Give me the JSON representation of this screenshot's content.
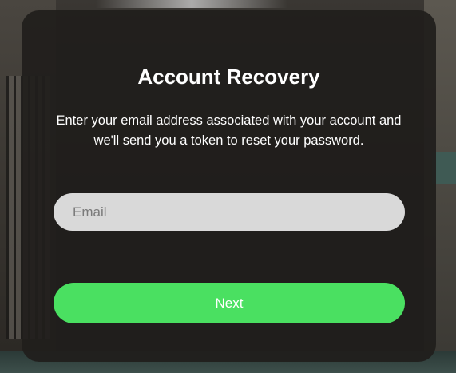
{
  "recovery": {
    "title": "Account Recovery",
    "description": "Enter your email address associated with your account and we'll send you a token to reset your password.",
    "email_placeholder": "Email",
    "email_value": "",
    "next_label": "Next"
  },
  "colors": {
    "accent": "#4ae061",
    "panel": "#201e1c",
    "input_bg": "#d9d9d9"
  }
}
